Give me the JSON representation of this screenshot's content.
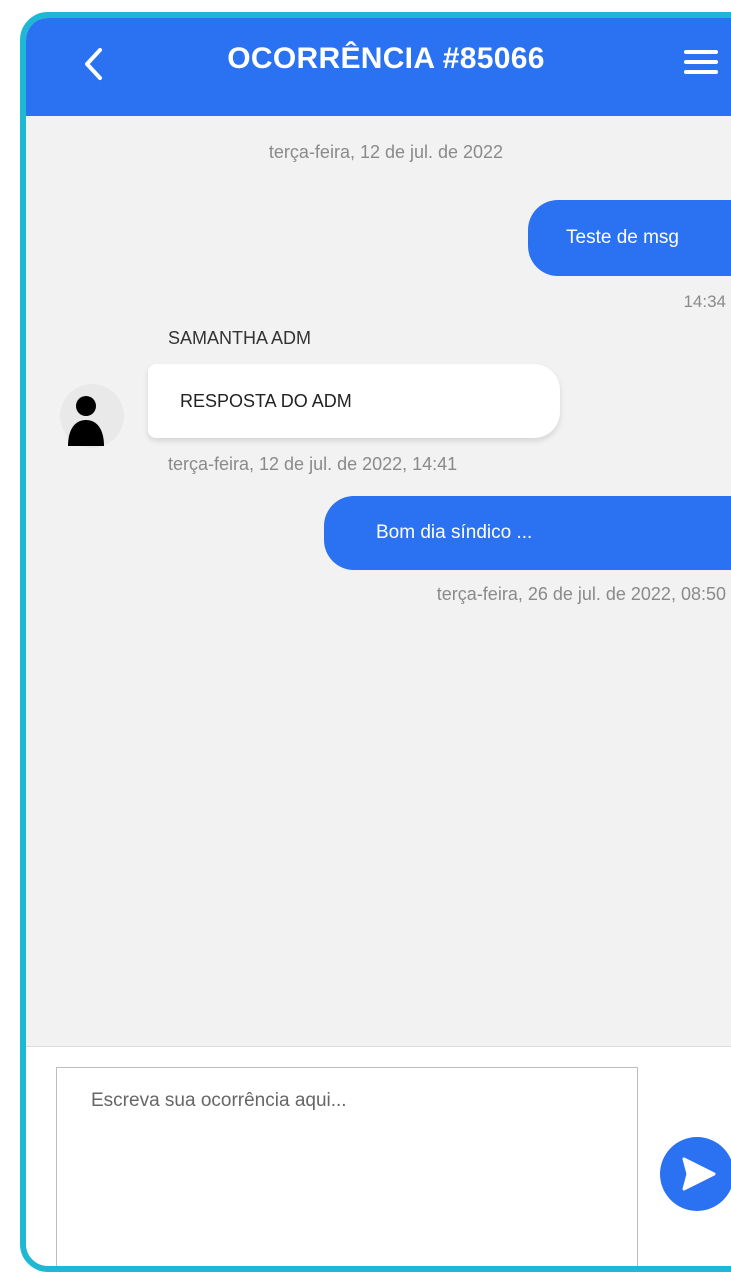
{
  "header": {
    "title": "OCORRÊNCIA #85066",
    "back_icon": "chevron-left-icon",
    "menu_icon": "hamburger-menu-icon"
  },
  "messages": {
    "date_separator": "terça-feira, 12 de jul. de 2022",
    "outgoing_1": {
      "text": "Teste de msg",
      "time": "14:34"
    },
    "incoming_1": {
      "sender": "SAMANTHA ADM",
      "text": "RESPOSTA DO ADM",
      "time": "terça-feira, 12 de jul. de 2022, 14:41",
      "avatar_icon": "person-icon"
    },
    "outgoing_2": {
      "text": "Bom dia síndico ...",
      "time": "terça-feira, 26 de jul. de 2022, 08:50"
    }
  },
  "composer": {
    "placeholder": "Escreva sua ocorrência aqui...",
    "value": "",
    "send_icon": "send-icon"
  },
  "colors": {
    "primary": "#2a72f2",
    "frame_border": "#1fb8d4",
    "chat_background": "#f2f2f2"
  }
}
